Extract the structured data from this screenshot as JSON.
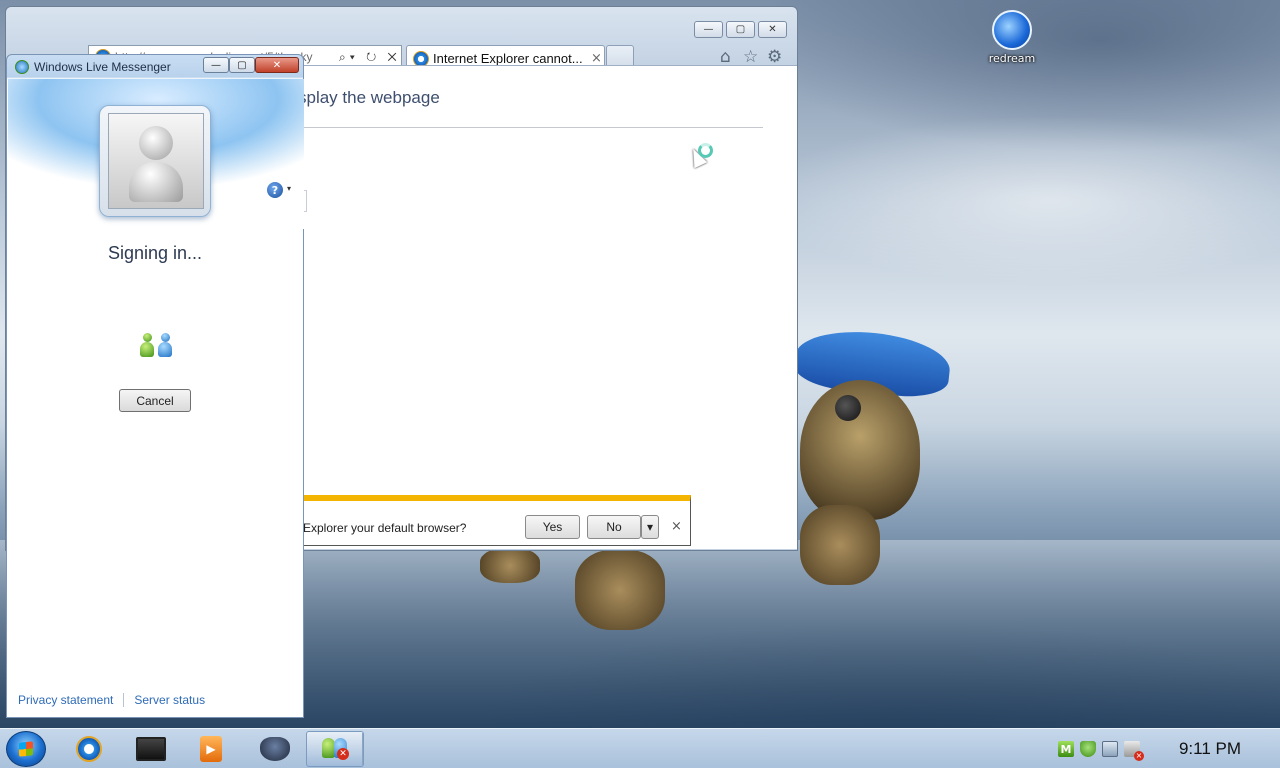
{
  "desktop": {
    "icons": [
      {
        "label": "redream",
        "icon": "redream-icon"
      }
    ]
  },
  "ie": {
    "address_url": "http://pages.msgpluslive.net/5/thanky",
    "address_tools": "⌕▾ ↻ ✕",
    "tab_title": "Internet Explorer cannot...",
    "tab_close": "×",
    "window_controls": {
      "minimize": "—",
      "maximize": "▢",
      "close": "✕"
    },
    "command_icons": {
      "home": "⌂",
      "favorites": "☆",
      "tools": "⚙"
    },
    "content_heading": "splay the webpage",
    "notification": {
      "text": "Explorer your default browser?",
      "yes_label": "Yes",
      "no_label": "No",
      "dropdown_glyph": "▾",
      "close_glyph": "×"
    }
  },
  "messenger": {
    "title": "Windows Live Messenger",
    "window_controls": {
      "minimize": "—",
      "maximize": "▢",
      "close": "✕"
    },
    "help_glyph": "?",
    "help_caret": "▾",
    "status_text": "Signing in...",
    "cancel_label": "Cancel",
    "footer_links": {
      "privacy": "Privacy statement",
      "server_status": "Server status"
    }
  },
  "taskbar": {
    "tray_m": "M",
    "clock": "9:11 PM",
    "wlm_error_glyph": "✕",
    "media_glyph": "▶"
  },
  "colors": {
    "notification_accent": "#f3b500",
    "link": "#2e6bb8",
    "heading": "#3d4e6e"
  }
}
